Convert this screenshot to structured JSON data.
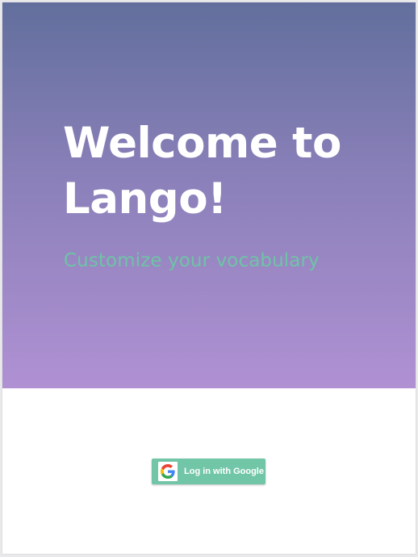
{
  "hero": {
    "title_line1": "Welcome to",
    "title_line2": "Lango!",
    "subtitle": "Customize your vocabulary"
  },
  "login": {
    "label": "Log in with Google",
    "icon": "google-g-icon"
  },
  "colors": {
    "gradient_top": "#626f9d",
    "gradient_bottom": "#b091d3",
    "accent": "#72c6a8",
    "subtitle": "#6fc3a6",
    "title": "#ffffff"
  }
}
